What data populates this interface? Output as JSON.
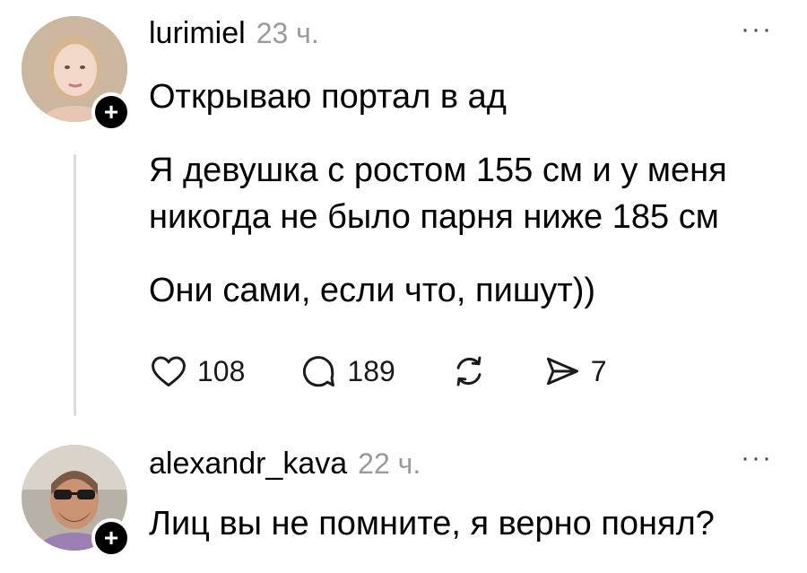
{
  "posts": [
    {
      "username": "lurimiel",
      "time": "23 ч.",
      "more": "···",
      "follow": "+",
      "paragraphs": [
        "Открываю портал в ад",
        "Я девушка с ростом 155 см и у меня никогда не было парня ниже 185 см",
        "Они сами, если что, пишут))"
      ],
      "actions": {
        "likes": "108",
        "comments": "189",
        "shares": "7"
      }
    },
    {
      "username": "alexandr_kava",
      "time": "22 ч.",
      "more": "···",
      "follow": "+",
      "paragraphs": [
        "Лиц вы не помните, я верно понял?"
      ]
    }
  ]
}
